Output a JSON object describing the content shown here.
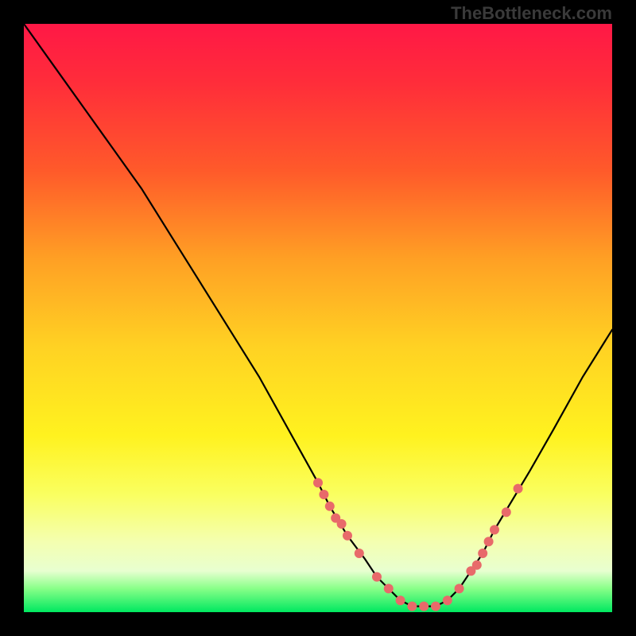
{
  "attribution": "TheBottleneck.com",
  "chart_data": {
    "type": "line",
    "title": "",
    "xlabel": "",
    "ylabel": "",
    "xlim": [
      0,
      100
    ],
    "ylim": [
      0,
      100
    ],
    "grid": false,
    "legend": false,
    "series": [
      {
        "name": "bottleneck-curve",
        "x": [
          0,
          5,
          10,
          15,
          20,
          25,
          30,
          35,
          40,
          45,
          50,
          52,
          55,
          58,
          60,
          62,
          64,
          66,
          68,
          70,
          72,
          74,
          76,
          78,
          80,
          83,
          86,
          90,
          95,
          100
        ],
        "values": [
          100,
          93,
          86,
          79,
          72,
          64,
          56,
          48,
          40,
          31,
          22,
          18,
          13,
          9,
          6,
          4,
          2,
          1,
          1,
          1,
          2,
          4,
          7,
          10,
          14,
          19,
          24,
          31,
          40,
          48
        ]
      }
    ],
    "markers": [
      {
        "name": "left-dots",
        "x": [
          50,
          51,
          52,
          53,
          54,
          55,
          57
        ],
        "y": [
          22,
          20,
          18,
          16,
          15,
          13,
          10
        ]
      },
      {
        "name": "bottom-dots",
        "x": [
          60,
          62,
          64,
          66,
          68,
          70,
          72,
          74
        ],
        "y": [
          6,
          4,
          2,
          1,
          1,
          1,
          2,
          4
        ]
      },
      {
        "name": "right-dots",
        "x": [
          76,
          77,
          78,
          79,
          80,
          82,
          84
        ],
        "y": [
          7,
          8,
          10,
          12,
          14,
          17,
          21
        ]
      }
    ],
    "gradient_stops": [
      {
        "pct": 0,
        "color": "#ff1846"
      },
      {
        "pct": 25,
        "color": "#ff5a2a"
      },
      {
        "pct": 55,
        "color": "#ffd223"
      },
      {
        "pct": 80,
        "color": "#faff60"
      },
      {
        "pct": 96,
        "color": "#88ff88"
      },
      {
        "pct": 100,
        "color": "#00e860"
      }
    ]
  }
}
